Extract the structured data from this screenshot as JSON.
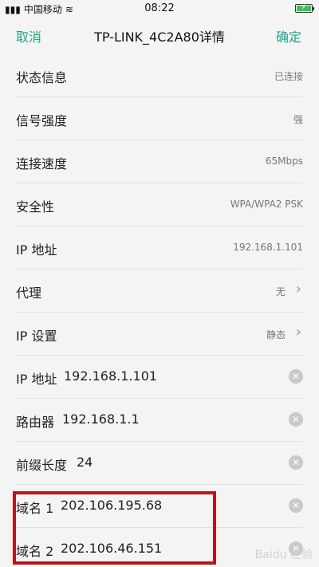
{
  "status_bar": {
    "carrier": "中国移动",
    "time": "08:22",
    "battery_level": 0.9
  },
  "title_bar": {
    "cancel": "取消",
    "title": "TP-LINK_4C2A80详情",
    "confirm": "确定"
  },
  "info_rows": [
    {
      "label": "状态信息",
      "value": "已连接"
    },
    {
      "label": "信号强度",
      "value": "强"
    },
    {
      "label": "连接速度",
      "value": "65Mbps"
    },
    {
      "label": "安全性",
      "value": "WPA/WPA2 PSK"
    },
    {
      "label": "IP 地址",
      "value": "192.168.1.101"
    },
    {
      "label": "代理",
      "value": "无"
    },
    {
      "label": "IP 设置",
      "value": "静态"
    }
  ],
  "edit_rows": [
    {
      "label": "IP 地址",
      "value": "192.168.1.101"
    },
    {
      "label": "路由器",
      "value": "192.168.1.1"
    },
    {
      "label": "前缀长度",
      "value": "24"
    },
    {
      "label": "域名 1",
      "value": "202.106.195.68"
    },
    {
      "label": "域名 2",
      "value": "202.106.46.151"
    }
  ],
  "watermark": "Baidu 经验",
  "accent_color": "#23a38a"
}
